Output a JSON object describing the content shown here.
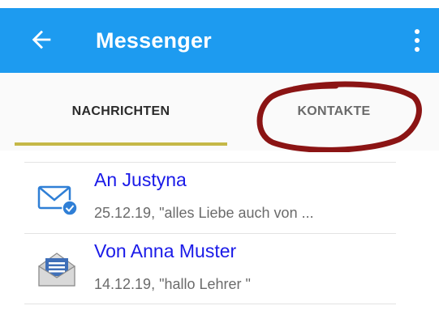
{
  "appbar": {
    "title": "Messenger",
    "back_icon": "arrow-left-icon",
    "menu_icon": "more-vert-icon",
    "background_color": "#1d9bf0"
  },
  "tabs": [
    {
      "label": "NACHRICHTEN",
      "selected": true
    },
    {
      "label": "KONTAKTE",
      "selected": false
    }
  ],
  "indicator_color": "#c5b847",
  "annotation_color": "#8b1414",
  "messages": [
    {
      "name": "An Justyna",
      "preview": "25.12.19, \"alles Liebe auch von ...",
      "icon": "mail-sent-icon"
    },
    {
      "name": "Von Anna Muster",
      "preview": "14.12.19, \"hallo Lehrer \"",
      "icon": "mail-open-icon"
    }
  ]
}
